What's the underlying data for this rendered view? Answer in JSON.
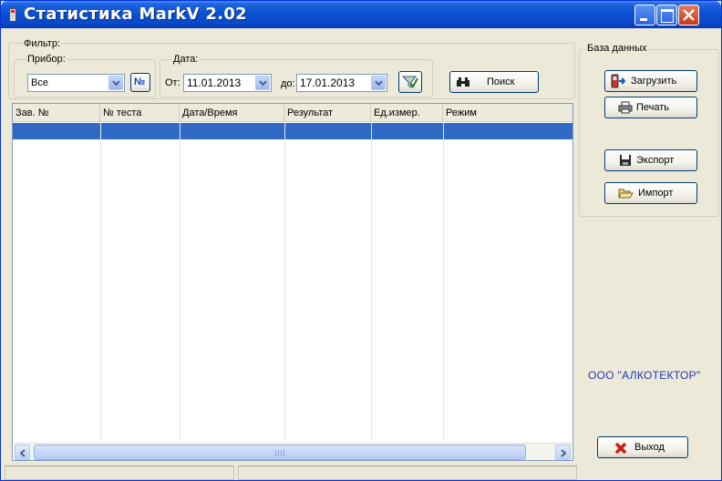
{
  "window": {
    "title": "Статистика MarkV 2.02"
  },
  "filter": {
    "group_label": "Фильтр:",
    "device_label": "Прибор:",
    "device_value": "Все",
    "number_button": "№",
    "date_group_label": "Дата:",
    "from_label": "От:",
    "from_value": "11.01.2013",
    "to_label": "до:",
    "to_value": "17.01.2013",
    "search_button": "Поиск"
  },
  "table": {
    "columns": [
      "Зав. №",
      "№ теста",
      "Дата/Время",
      "Результат",
      "Ед.измер.",
      "Режим"
    ],
    "rows": []
  },
  "database": {
    "group_label": "База данных",
    "load_button": "Загрузить",
    "print_button": "Печать",
    "export_button": "Экспорт",
    "import_button": "Импорт"
  },
  "company": "ООО \"АЛКОТЕКТОР\"",
  "exit_button": "Выход",
  "colors": {
    "selection": "#316ac5",
    "titlebar": "#0a4fd1",
    "company_text": "#2238b0"
  }
}
